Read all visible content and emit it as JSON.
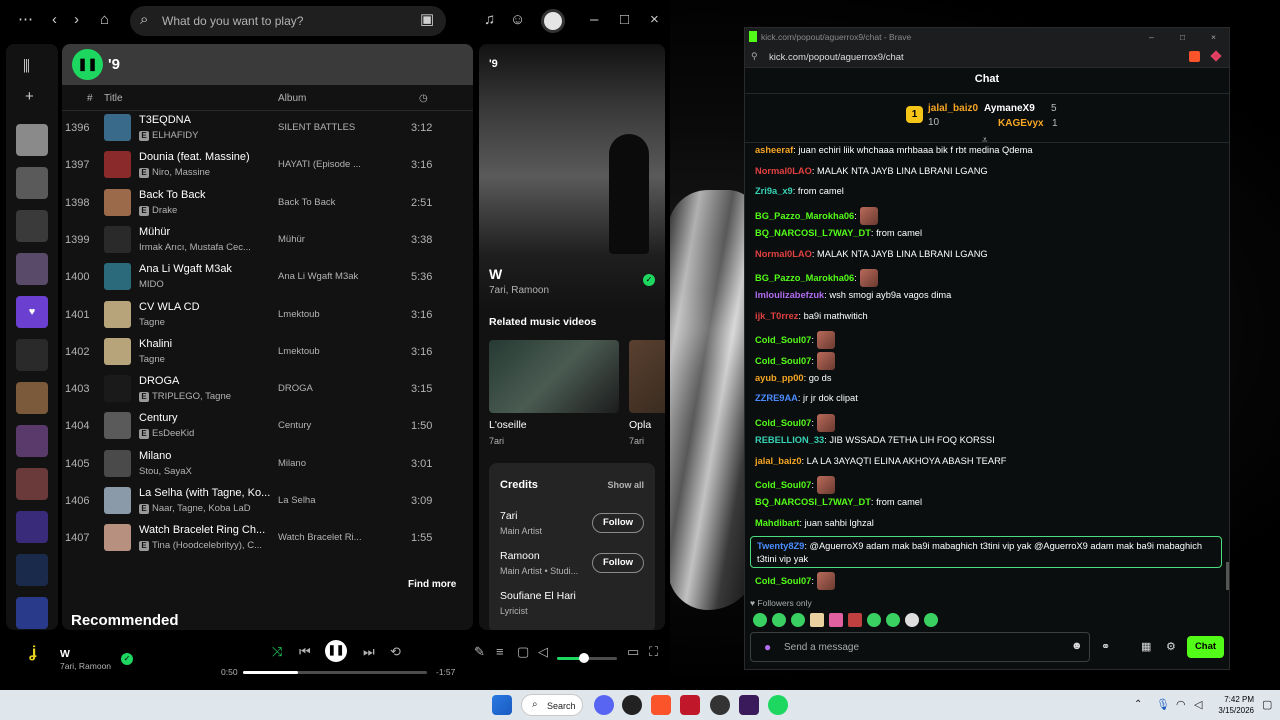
{
  "spotify": {
    "search_placeholder": "What do you want to play?",
    "playlist_title": "'9",
    "columns": {
      "num": "#",
      "title": "Title",
      "album": "Album"
    },
    "rows": [
      {
        "num": "1396",
        "title": "T3EQDNA",
        "artist": "ELHAFIDY",
        "explicit": true,
        "album": "SILENT BATTLES",
        "duration": "3:12",
        "color": "#3a6a8a"
      },
      {
        "num": "1397",
        "title": "Dounia (feat. Massine)",
        "artist": "Niro, Massine",
        "explicit": true,
        "album": "HAYATI (Episode ...",
        "duration": "3:16",
        "color": "#8a2a2a"
      },
      {
        "num": "1398",
        "title": "Back To Back",
        "artist": "Drake",
        "explicit": true,
        "album": "Back To Back",
        "duration": "2:51",
        "color": "#9a6a4a"
      },
      {
        "num": "1399",
        "title": "Mühür",
        "artist": "Irmak Arıcı, Mustafa Cec...",
        "explicit": false,
        "album": "Mühür",
        "duration": "3:38",
        "color": "#2a2a2a"
      },
      {
        "num": "1400",
        "title": "Ana Li Wgaft M3ak",
        "artist": "MIDO",
        "explicit": false,
        "album": "Ana Li Wgaft M3ak",
        "duration": "5:36",
        "color": "#2a6a7a"
      },
      {
        "num": "1401",
        "title": "CV WLA CD",
        "artist": "Tagne",
        "explicit": false,
        "album": "Lmektoub",
        "duration": "3:16",
        "color": "#b8a47a"
      },
      {
        "num": "1402",
        "title": "Khalini",
        "artist": "Tagne",
        "explicit": false,
        "album": "Lmektoub",
        "duration": "3:16",
        "color": "#b8a47a"
      },
      {
        "num": "1403",
        "title": "DROGA",
        "artist": "TRIPLEGO, Tagne",
        "explicit": true,
        "album": "DROGA",
        "duration": "3:15",
        "color": "#1a1a1a"
      },
      {
        "num": "1404",
        "title": "Century",
        "artist": "EsDeeKid",
        "explicit": true,
        "album": "Century",
        "duration": "1:50",
        "color": "#5a5a5a"
      },
      {
        "num": "1405",
        "title": "Milano",
        "artist": "Stou, SayaX",
        "explicit": false,
        "album": "Milano",
        "duration": "3:01",
        "color": "#4a4a4a"
      },
      {
        "num": "1406",
        "title": "La Selha (with Tagne, Ko...",
        "artist": "Naar, Tagne, Koba LaD",
        "explicit": true,
        "album": "La Selha",
        "duration": "3:09",
        "color": "#8a9aa8"
      },
      {
        "num": "1407",
        "title": "Watch Bracelet Ring Ch...",
        "artist": "Tina (Hoodcelebrityy), C...",
        "explicit": true,
        "album": "Watch Bracelet Ri...",
        "duration": "1:55",
        "color": "#b89080"
      }
    ],
    "find_more": "Find more",
    "recommended": "Recommended",
    "right": {
      "title": "'9",
      "song": "W",
      "artists": "7ari, Ramoon",
      "related_videos_label": "Related music videos",
      "videos": [
        {
          "title": "L'oseille",
          "artist": "7ari"
        },
        {
          "title": "Opla",
          "artist": "7ari"
        }
      ],
      "credits_label": "Credits",
      "show_all": "Show all",
      "credits": [
        {
          "name": "7ari",
          "role": "Main Artist",
          "follow": "Follow"
        },
        {
          "name": "Ramoon",
          "role": "Main Artist • Studi...",
          "follow": "Follow"
        },
        {
          "name": "Soufiane El Hari",
          "role": "Lyricist"
        }
      ]
    },
    "player": {
      "title": "W",
      "artists": "7ari, Ramoon",
      "elapsed": "0:50",
      "remaining": "-1:57",
      "progress": 0.3,
      "volume": 0.45
    }
  },
  "kick": {
    "window_title": "kick.com/popout/aguerrox9/chat - Brave",
    "url": "kick.com/popout/aguerrox9/chat",
    "chat_title": "Chat",
    "gifters": [
      {
        "rank": "1",
        "name": "jalal_baiz0",
        "count": "10"
      },
      {
        "name": "AymaneX9",
        "count": "5"
      },
      {
        "name": "KAGEvyx",
        "count": "1"
      }
    ],
    "messages": [
      {
        "user": "asheeraf",
        "text": ": juan echiri liik whchaaa mrhbaaa bik f rbt medina Qdema",
        "color": "#f5a623"
      },
      {
        "user": "Normal0LAO",
        "text": ": MALAK NTA JAYB LINA LBRANI LGANG",
        "color": "#e04040"
      },
      {
        "user": "Zri9a_x9",
        "text": ": from camel",
        "color": "#37d3b5"
      },
      {
        "user": "BG_Pazzo_Marokha06",
        "text": ":",
        "color": "#53fc18",
        "emote": true
      },
      {
        "user": "BQ_NARCOSI_L7WAY_DT",
        "text": ": from camel",
        "color": "#53fc18"
      },
      {
        "user": "Normal0LAO",
        "text": ": MALAK NTA JAYB LINA LBRANI LGANG",
        "color": "#e04040"
      },
      {
        "user": "BG_Pazzo_Marokha06",
        "text": ":",
        "color": "#53fc18",
        "emote": true
      },
      {
        "user": "lmloulizabefzuk",
        "text": ": wsh smogi ayb9a vagos dima",
        "color": "#b16cf0"
      },
      {
        "user": "ijk_T0rrez",
        "text": ": ba9i mathwitich",
        "color": "#e04040"
      },
      {
        "user": "Cold_Soul07",
        "text": ":",
        "color": "#53fc18",
        "emote": true
      },
      {
        "user": "Cold_Soul07",
        "text": ":",
        "color": "#53fc18",
        "emote": true
      },
      {
        "user": "ayub_pp00",
        "text": ": go ds",
        "color": "#f5a623"
      },
      {
        "user": "ZZRE9AA",
        "text": ": jr jr dok clipat",
        "color": "#4a8cff"
      },
      {
        "user": "Cold_Soul07",
        "text": ":",
        "color": "#53fc18",
        "emote": true
      },
      {
        "user": "REBELLION_33",
        "text": ": JIB WSSADA 7ETHA LIH FOQ KORSSI",
        "color": "#37d3b5"
      },
      {
        "user": "jalal_baiz0",
        "text": ": LA LA 3AYAQTI ELINA AKHOYA ABASH TEARF",
        "color": "#f5a623"
      },
      {
        "user": "Cold_Soul07",
        "text": ":",
        "color": "#53fc18",
        "emote": true
      },
      {
        "user": "BQ_NARCOSI_L7WAY_DT",
        "text": ": from camel",
        "color": "#53fc18"
      },
      {
        "user": "Mahdibart",
        "text": ": juan sahbi lghzal",
        "color": "#53fc18"
      }
    ],
    "highlight": {
      "user": "Twenty8Z9",
      "text": ": @AguerroX9 adam mak ba9i mabaghich t3tini vip yak @AguerroX9 adam mak ba9i mabaghich t3tini vip yak"
    },
    "last_message": {
      "user": "Cold_Soul07",
      "text": ":"
    },
    "followers_only": "Followers only",
    "send_placeholder": "Send a message",
    "chat_button": "Chat"
  },
  "taskbar": {
    "search": "Search",
    "time": "7:42 PM",
    "date": "3/15/2026"
  }
}
